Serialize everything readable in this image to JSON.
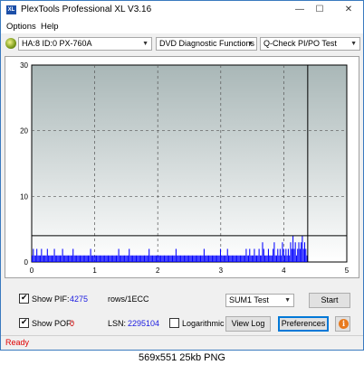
{
  "window": {
    "title": "PlexTools Professional XL V3.16",
    "icon_label": "XL",
    "minimize_glyph": "—",
    "maximize_glyph": "☐",
    "close_glyph": "✕"
  },
  "menu": {
    "items": [
      "Options",
      "Help"
    ]
  },
  "toolbar": {
    "drive_combo": "HA:8 ID:0  PX-760A",
    "function_combo": "DVD Diagnostic Functions",
    "test_combo": "Q-Check PI/PO Test"
  },
  "colors": {
    "accent": "#0078d7",
    "bars": "#0000ff",
    "status": "#e00000",
    "value_blue": "#1a1ae0",
    "value_red": "#e00000"
  },
  "chart_data": {
    "type": "bar",
    "x_ticks": [
      "0",
      "1",
      "2",
      "3",
      "4",
      "5"
    ],
    "y_ticks": [
      "0",
      "10",
      "20",
      "30"
    ],
    "xlim": [
      0,
      5
    ],
    "ylim": [
      0,
      30
    ],
    "grid": true,
    "threshold": 4,
    "end_marker_x": 4.38,
    "series": [
      {
        "values": [
          1,
          2,
          1,
          1,
          2,
          1,
          1,
          1,
          2,
          1,
          1,
          1,
          1,
          2,
          1,
          1,
          1,
          1,
          1,
          2,
          1,
          1,
          1,
          1,
          1,
          1,
          2,
          1,
          1,
          1,
          1,
          1,
          1,
          1,
          1,
          2,
          1,
          1,
          1,
          1,
          1,
          1,
          1,
          1,
          1,
          1,
          1,
          1,
          1,
          1,
          2,
          1,
          1,
          1,
          1,
          1,
          1,
          1,
          1,
          1,
          1,
          1,
          1,
          1,
          1,
          1,
          1,
          1,
          1,
          1,
          1,
          1,
          1,
          1,
          2,
          1,
          1,
          1,
          1,
          1,
          1,
          1,
          1,
          2,
          1,
          1,
          1,
          1,
          1,
          1,
          1,
          1,
          1,
          1,
          1,
          1,
          1,
          1,
          1,
          1,
          2,
          1,
          1,
          1,
          1,
          1,
          1,
          1,
          1,
          1,
          1,
          1,
          1,
          1,
          1,
          1,
          1,
          1,
          1,
          1,
          1,
          1,
          1,
          2,
          1,
          1,
          1,
          1,
          1,
          1,
          1,
          1,
          1,
          1,
          1,
          1,
          1,
          1,
          1,
          1,
          1,
          1,
          1,
          1,
          1,
          1,
          1,
          2,
          1,
          1,
          1,
          1,
          1,
          1,
          1,
          1,
          1,
          1,
          1,
          1,
          1,
          2,
          1,
          1,
          1,
          1,
          1,
          2,
          1,
          1,
          1,
          1,
          1,
          1,
          1,
          1,
          1,
          1,
          1,
          1,
          1,
          1,
          1,
          2,
          1,
          1,
          2,
          1,
          1,
          1,
          2,
          1,
          1,
          1,
          2,
          1,
          1,
          3,
          2,
          1,
          1,
          1,
          2,
          1,
          1,
          1,
          2,
          3,
          1,
          1,
          2,
          1,
          2,
          1,
          3,
          2,
          1,
          2,
          1,
          2,
          1,
          3,
          2,
          4,
          2,
          3,
          1,
          2,
          3,
          2,
          3,
          4,
          2,
          3,
          2,
          1
        ]
      }
    ]
  },
  "controls": {
    "show_pif_label": "Show PIF:",
    "pif_value": "4275",
    "rows_label": "rows/1ECC",
    "show_pof_label": "Show POF:",
    "pof_value": "0",
    "lsn_label": "LSN:",
    "lsn_value": "2295104",
    "logarithmic_label": "Logarithmic",
    "sum_combo": "SUM1 Test",
    "start_label": "Start",
    "view_log_label": "View Log",
    "preferences_label": "Preferences",
    "info_glyph": "i"
  },
  "status": {
    "text": "Ready"
  },
  "caption": "569x551  25kb  PNG"
}
